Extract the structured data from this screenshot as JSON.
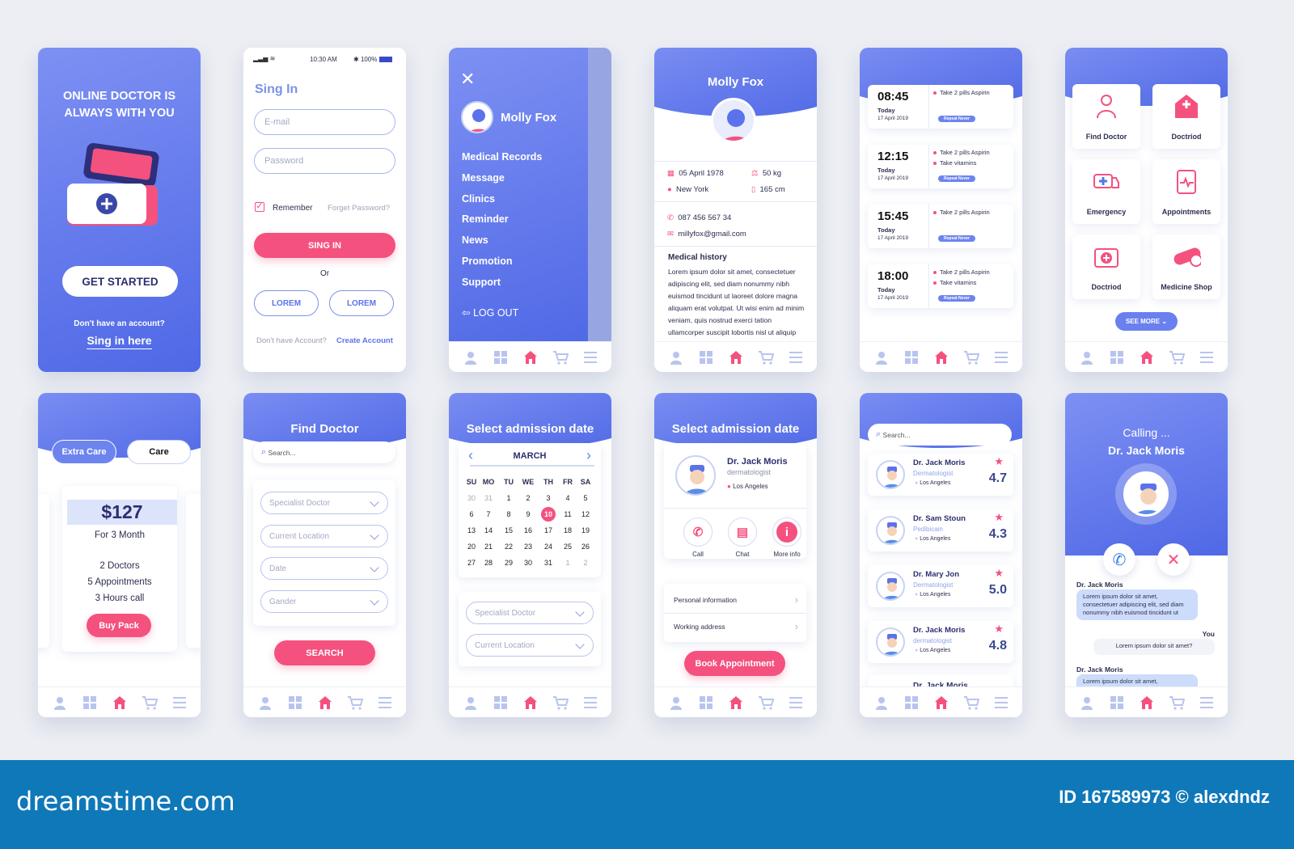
{
  "colors": {
    "primary": "#5b72ea",
    "accent": "#f4517f",
    "text_dark": "#2c2f6e",
    "footer": "#0f78b8"
  },
  "bottom_nav": {
    "icons": [
      "user-icon",
      "grid-icon",
      "home-icon",
      "cart-icon",
      "menu-icon"
    ],
    "active": "home-icon"
  },
  "onboarding": {
    "title_line1": "ONLINE DOCTOR IS",
    "title_line2": "ALWAYS WITH YOU",
    "cta": "GET STARTED",
    "no_account": "Don't have an account?",
    "sign_in_link": "Sing in here"
  },
  "sign_in": {
    "status": {
      "time": "10:30 AM",
      "battery": "100%"
    },
    "title": "Sing In",
    "email_placeholder": "E-mail",
    "password_placeholder": "Password",
    "remember": "Remember",
    "remember_checked": true,
    "forgot": "Forget Password?",
    "submit": "SING IN",
    "or": "Or",
    "social": [
      "LOREM",
      "LOREM"
    ],
    "no_account": "Don't have Account?",
    "create": "Create Account"
  },
  "menu": {
    "user": "Molly Fox",
    "items": [
      "Medical Records",
      "Message",
      "Clinics",
      "Reminder",
      "News",
      "Promotion",
      "Support"
    ],
    "logout": "LOG OUT"
  },
  "profile": {
    "name": "Molly Fox",
    "birthdate": "05 April 1978",
    "city": "New York",
    "weight": "50 kg",
    "height": "165 cm",
    "phone": "087 456 567 34",
    "email": "millyfox@gmail.com",
    "history_title": "Medical history",
    "history_text": "Lorem ipsum dolor sit amet, consectetuer adipiscing elit, sed diam nonummy nibh euismod tincidunt ut laoreet dolore magna aliquam erat volutpat. Ut wisi enim ad minim veniam, quis nostrud exerci tation ullamcorper suscipit lobortis nisl ut aliquip"
  },
  "reminders": {
    "items": [
      {
        "time": "08:45",
        "day": "Today",
        "date": "17 April 2019",
        "tasks": [
          "Take 2 pills Aspirin"
        ],
        "badge": "Repeat Never"
      },
      {
        "time": "12:15",
        "day": "Today",
        "date": "17 April 2019",
        "tasks": [
          "Take 2 pills Aspirin",
          "Take vitamins"
        ],
        "badge": "Repeat Never"
      },
      {
        "time": "15:45",
        "day": "Today",
        "date": "17 April 2019",
        "tasks": [
          "Take 2 pills Aspirin"
        ],
        "badge": "Repeat Never"
      },
      {
        "time": "18:00",
        "day": "Today",
        "date": "17 April 2019",
        "tasks": [
          "Take 2 pills Aspirin",
          "Take vitamins"
        ],
        "badge": "Repeat Never"
      }
    ]
  },
  "services": {
    "tiles": [
      {
        "label": "Find Doctor",
        "icon": "doctor-icon"
      },
      {
        "label": "Doctriod",
        "icon": "hospital-icon"
      },
      {
        "label": "Emergency",
        "icon": "ambulance-icon"
      },
      {
        "label": "Appointments",
        "icon": "clipboard-icon"
      },
      {
        "label": "Doctriod",
        "icon": "first-aid-kit-icon"
      },
      {
        "label": "Medicine Shop",
        "icon": "pill-icon"
      }
    ],
    "see_more": "SEE MORE"
  },
  "pricing": {
    "tabs": [
      "Extra Care",
      "Care"
    ],
    "active_tab": 0,
    "price": "$127",
    "period": "For 3 Month",
    "features": [
      "2 Doctors",
      "5 Appointments",
      "3 Hours call"
    ],
    "buy": "Buy Pack"
  },
  "find_doctor": {
    "title": "Find Doctor",
    "search_placeholder": "Search...",
    "selects": [
      "Specialist Doctor",
      "Current Location",
      "Date",
      "Gander"
    ],
    "submit": "SEARCH"
  },
  "calendar": {
    "title": "Select admission date",
    "month": "MARCH",
    "weekdays": [
      "SU",
      "MO",
      "TU",
      "WE",
      "TH",
      "FR",
      "SA"
    ],
    "weeks": [
      [
        30,
        31,
        1,
        2,
        3,
        4,
        5
      ],
      [
        6,
        7,
        8,
        9,
        10,
        11,
        12
      ],
      [
        13,
        14,
        15,
        16,
        17,
        18,
        19
      ],
      [
        20,
        21,
        22,
        23,
        24,
        25,
        26
      ],
      [
        27,
        28,
        29,
        30,
        31,
        1,
        2
      ]
    ],
    "selected": 10,
    "selects": [
      "Specialist Doctor",
      "Current Location"
    ]
  },
  "doctor_detail": {
    "title": "Select admission date",
    "name": "Dr. Jack Moris",
    "specialty": "dermatologist",
    "location": "Los Angeles",
    "actions": [
      {
        "label": "Call",
        "icon": "phone-icon"
      },
      {
        "label": "Chat",
        "icon": "chat-icon"
      },
      {
        "label": "More info",
        "icon": "info-icon"
      }
    ],
    "rows": [
      "Personal information",
      "Working address"
    ],
    "book": "Book Appointment"
  },
  "doctor_list": {
    "search_placeholder": "Search...",
    "doctors": [
      {
        "name": "Dr. Jack Moris",
        "specialty": "Dermatologist",
        "location": "Los Angeles",
        "rating": "4.7"
      },
      {
        "name": "Dr. Sam Stoun",
        "specialty": "Pedibicain",
        "location": "Los Angeles",
        "rating": "4.3"
      },
      {
        "name": "Dr. Mary Jon",
        "specialty": "Dermatologist",
        "location": "Los Angeles",
        "rating": "5.0"
      },
      {
        "name": "Dr. Jack Moris",
        "specialty": "dermatologist",
        "location": "Los Angeles",
        "rating": "4.8"
      }
    ],
    "partial": "Dr. Jack Moris"
  },
  "calling": {
    "status": "Calling ...",
    "name": "Dr. Jack Moris",
    "messages": [
      {
        "sender": "Dr. Jack Moris",
        "text": "Lorem ipsum dolor sit amet, consectetuer adipiscing elit, sed diam nonummy nibh euismod tincidunt ut",
        "side": "left"
      },
      {
        "sender": "You",
        "text": "Lorem ipsum dolor sit amet?",
        "side": "right"
      },
      {
        "sender": "Dr. Jack Moris",
        "text": "Lorem ipsum dolor sit amet, consectetuer adipiscing elit, sed diam",
        "side": "left"
      }
    ]
  },
  "footer": {
    "brand": "dreamstime.com",
    "credit": "ID 167589973 © alexdndz"
  }
}
